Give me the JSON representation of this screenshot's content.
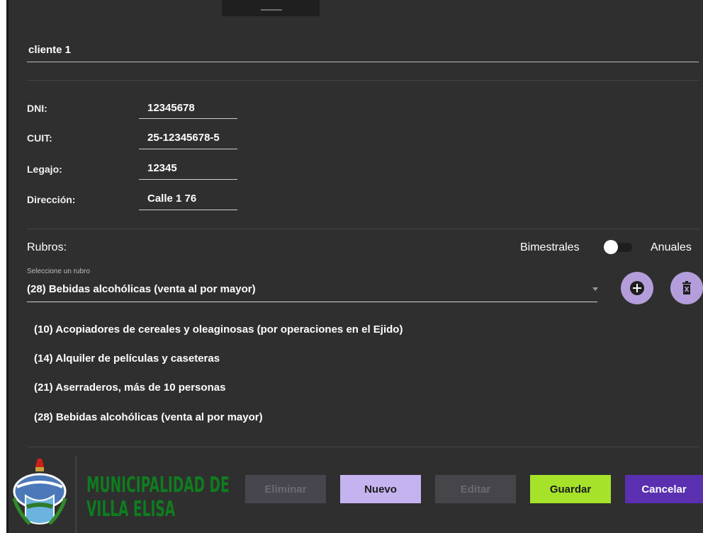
{
  "client": {
    "name": "cliente 1"
  },
  "fields": [
    {
      "label": "DNI:",
      "value": "12345678"
    },
    {
      "label": "CUIT:",
      "value": "25-12345678-5"
    },
    {
      "label": "Legajo:",
      "value": "12345"
    },
    {
      "label": "Dirección:",
      "value": "Calle 1 76"
    }
  ],
  "rubros": {
    "title": "Rubros:",
    "toggle_left_label": "Bimestrales",
    "toggle_right_label": "Anuales",
    "toggle_state": "Bimestrales",
    "select_label": "Seleccione un rubro",
    "select_value": "(28) Bebidas alcohólicas (venta al por mayor)",
    "add_icon": "add-circle-icon",
    "delete_icon": "delete-icon",
    "items": [
      "(10) Acopiadores de cereales y oleaginosas (por operaciones en el Ejido)",
      "(14) Alquiler de películas y caseteras",
      "(21) Aserraderos, más de 10 personas",
      "(28) Bebidas alcohólicas (venta al por mayor)"
    ]
  },
  "branding": {
    "line1": "MUNICIPALIDAD DE",
    "line2": "VILLA ELISA",
    "color": "#0f7d1f"
  },
  "actions": {
    "eliminar": "Eliminar",
    "nuevo": "Nuevo",
    "editar": "Editar",
    "guardar": "Guardar",
    "cancelar": "Cancelar"
  },
  "colors": {
    "background": "#2f2f2f",
    "accent_purple": "#b39ddb",
    "guardar_green": "#a7e22a",
    "cancelar_purple": "#5a2fb0"
  }
}
